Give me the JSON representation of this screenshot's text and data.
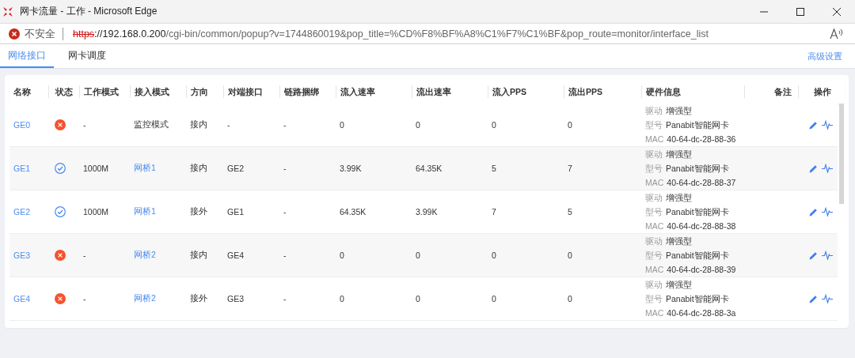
{
  "window": {
    "title": "网卡流量 - 工作 - Microsoft Edge"
  },
  "address_bar": {
    "security_label": "不安全",
    "url_parts": [
      {
        "kind": "struck-scheme",
        "text": "https"
      },
      {
        "kind": "host",
        "text": "://192.168.0.200"
      },
      {
        "kind": "path",
        "text": "/cgi-bin/common/popup?v=1744860019&pop_title=%CD%F8%BF%A8%C1%F7%C1%BF&pop_route=monitor/interface_list"
      }
    ]
  },
  "tabs": [
    {
      "label": "网络接口",
      "selected": true
    },
    {
      "label": "网卡调度",
      "selected": false
    }
  ],
  "advanced_link": "高级设置",
  "table": {
    "columns": [
      "名称",
      "状态",
      "工作模式",
      "接入模式",
      "方向",
      "对端接口",
      "链路捆绑",
      "流入速率",
      "流出速率",
      "流入PPS",
      "流出PPS",
      "硬件信息",
      "备注",
      "操作"
    ],
    "rows": [
      {
        "name": "GE0",
        "up": false,
        "work_mode": "-",
        "access_mode": {
          "kind": "text",
          "text": "监控模式"
        },
        "direction": "接内",
        "peer": "-",
        "bond": "-",
        "in_rate": "0",
        "out_rate": "0",
        "in_pps": "0",
        "out_pps": "0",
        "hardware": [
          {
            "label": "驱动",
            "value": "增强型"
          },
          {
            "label": "型号",
            "value": "Panabit智能网卡"
          },
          {
            "label": "MAC",
            "value": "40-64-dc-28-88-36"
          }
        ]
      },
      {
        "name": "GE1",
        "up": true,
        "work_mode": "1000M",
        "access_mode": {
          "kind": "link",
          "text": "网桥1"
        },
        "direction": "接内",
        "peer": "GE2",
        "bond": "-",
        "in_rate": "3.99K",
        "out_rate": "64.35K",
        "in_pps": "5",
        "out_pps": "7",
        "hardware": [
          {
            "label": "驱动",
            "value": "增强型"
          },
          {
            "label": "型号",
            "value": "Panabit智能网卡"
          },
          {
            "label": "MAC",
            "value": "40-64-dc-28-88-37"
          }
        ]
      },
      {
        "name": "GE2",
        "up": true,
        "work_mode": "1000M",
        "access_mode": {
          "kind": "link",
          "text": "网桥1"
        },
        "direction": "接外",
        "peer": "GE1",
        "bond": "-",
        "in_rate": "64.35K",
        "out_rate": "3.99K",
        "in_pps": "7",
        "out_pps": "5",
        "hardware": [
          {
            "label": "驱动",
            "value": "增强型"
          },
          {
            "label": "型号",
            "value": "Panabit智能网卡"
          },
          {
            "label": "MAC",
            "value": "40-64-dc-28-88-38"
          }
        ]
      },
      {
        "name": "GE3",
        "up": false,
        "work_mode": "-",
        "access_mode": {
          "kind": "link",
          "text": "网桥2"
        },
        "direction": "接内",
        "peer": "GE4",
        "bond": "-",
        "in_rate": "0",
        "out_rate": "0",
        "in_pps": "0",
        "out_pps": "0",
        "hardware": [
          {
            "label": "驱动",
            "value": "增强型"
          },
          {
            "label": "型号",
            "value": "Panabit智能网卡"
          },
          {
            "label": "MAC",
            "value": "40-64-dc-28-88-39"
          }
        ]
      },
      {
        "name": "GE4",
        "up": false,
        "work_mode": "-",
        "access_mode": {
          "kind": "link",
          "text": "网桥2"
        },
        "direction": "接外",
        "peer": "GE3",
        "bond": "-",
        "in_rate": "0",
        "out_rate": "0",
        "in_pps": "0",
        "out_pps": "0",
        "hardware": [
          {
            "label": "驱动",
            "value": "增强型"
          },
          {
            "label": "型号",
            "value": "Panabit智能网卡"
          },
          {
            "label": "MAC",
            "value": "40-64-dc-28-88-3a"
          }
        ]
      }
    ]
  }
}
